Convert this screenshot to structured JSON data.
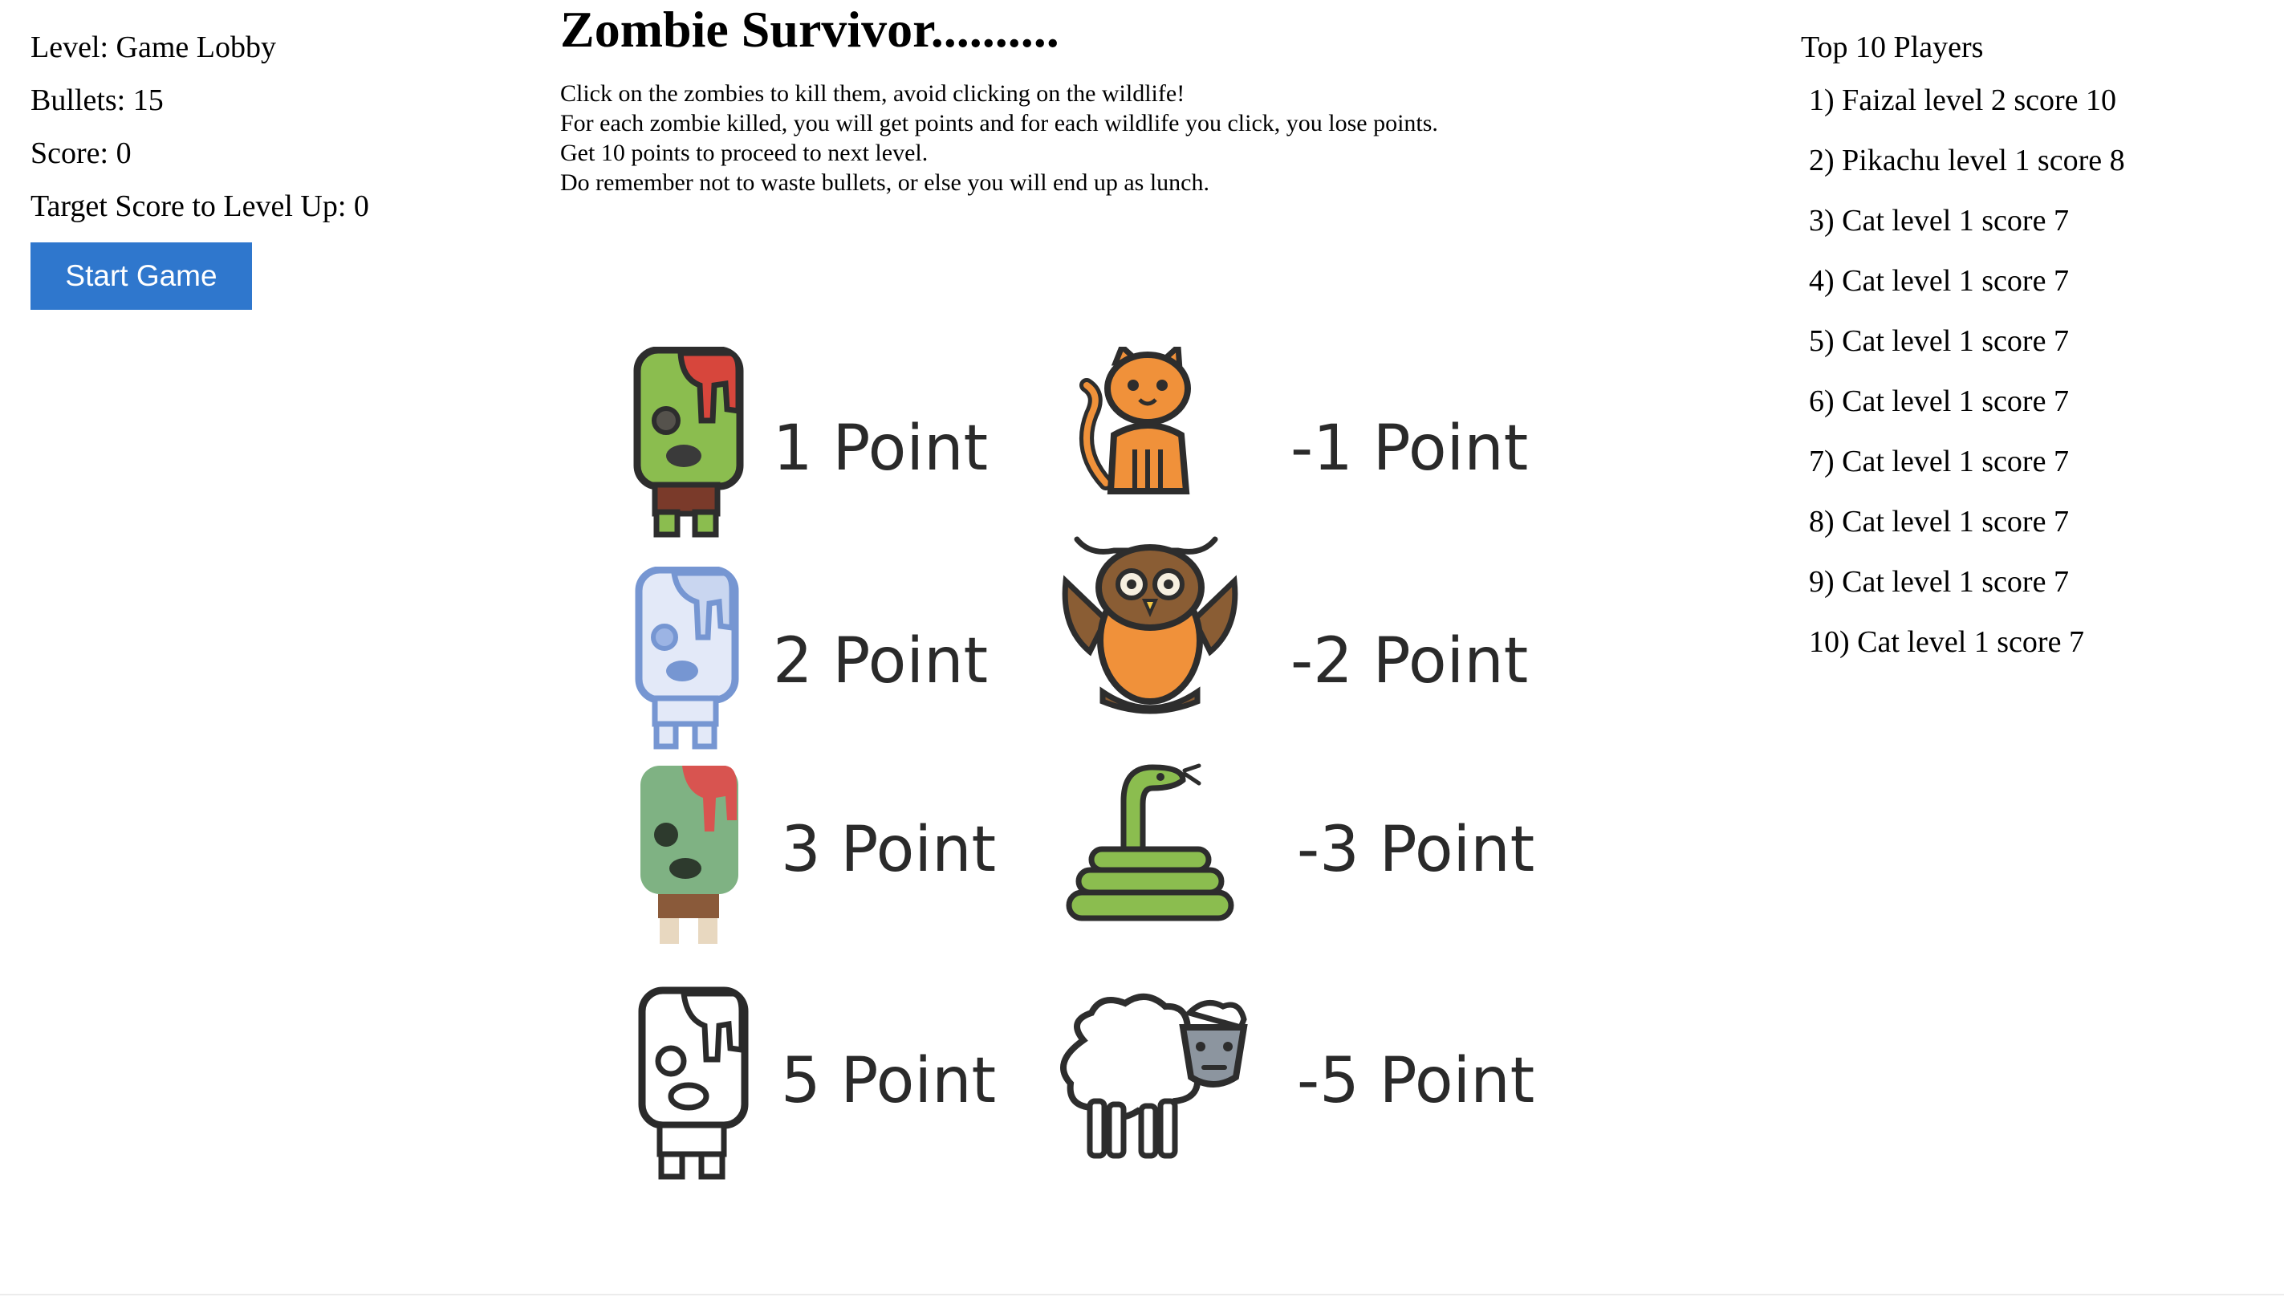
{
  "status": {
    "level": "Level: Game Lobby",
    "bullets": "Bullets: 15",
    "score": "Score: 0",
    "target": "Target Score to Level Up: 0",
    "start_button": "Start Game"
  },
  "colors": {
    "start_button_bg": "#2f77cd"
  },
  "game": {
    "title": "Zombie Survivor..........",
    "instructions": [
      "Click on the zombies to kill them, avoid clicking on the wildlife!",
      "For each zombie killed, you will get points and for each wildlife you click, you lose points.",
      "Get 10 points to proceed to next level.",
      "Do remember not to waste bullets, or else you will end up as lunch."
    ]
  },
  "legend": {
    "zombies": [
      {
        "icon": "green-zombie-icon",
        "points": "1 Point"
      },
      {
        "icon": "blue-zombie-icon",
        "points": "2 Point"
      },
      {
        "icon": "faded-green-zombie-icon",
        "points": "3 Point"
      },
      {
        "icon": "outline-zombie-icon",
        "points": "5 Point"
      }
    ],
    "wildlife": [
      {
        "icon": "cat-icon",
        "points": "-1 Point"
      },
      {
        "icon": "owl-icon",
        "points": "-2 Point"
      },
      {
        "icon": "snake-icon",
        "points": "-3 Point"
      },
      {
        "icon": "sheep-icon",
        "points": "-5 Point"
      }
    ]
  },
  "leaderboard": {
    "title": "Top 10 Players",
    "entries": [
      "1) Faizal level 2 score 10",
      "2) Pikachu level 1 score 8",
      "3) Cat level 1 score 7",
      "4) Cat level 1 score 7",
      "5) Cat level 1 score 7",
      "6) Cat level 1 score 7",
      "7) Cat level 1 score 7",
      "8) Cat level 1 score 7",
      "9) Cat level 1 score 7",
      "10) Cat level 1 score 7"
    ]
  }
}
